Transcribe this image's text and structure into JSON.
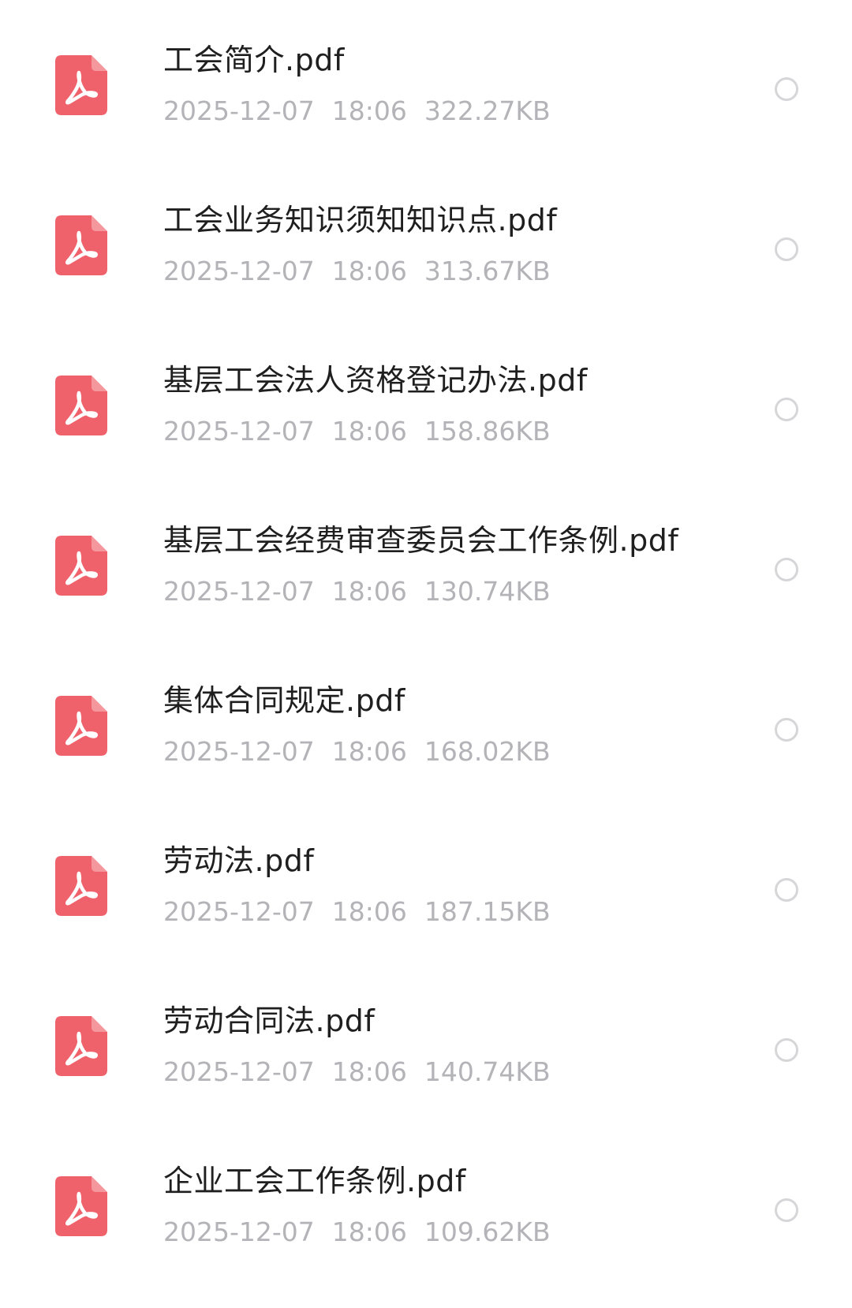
{
  "files": [
    {
      "name": "工会简介.pdf",
      "date": "2025-12-07",
      "time": "18:06",
      "size": "322.27KB"
    },
    {
      "name": "工会业务知识须知知识点.pdf",
      "date": "2025-12-07",
      "time": "18:06",
      "size": "313.67KB"
    },
    {
      "name": "基层工会法人资格登记办法.pdf",
      "date": "2025-12-07",
      "time": "18:06",
      "size": "158.86KB"
    },
    {
      "name": "基层工会经费审查委员会工作条例.pdf",
      "date": "2025-12-07",
      "time": "18:06",
      "size": "130.74KB"
    },
    {
      "name": "集体合同规定.pdf",
      "date": "2025-12-07",
      "time": "18:06",
      "size": "168.02KB"
    },
    {
      "name": "劳动法.pdf",
      "date": "2025-12-07",
      "time": "18:06",
      "size": "187.15KB"
    },
    {
      "name": "劳动合同法.pdf",
      "date": "2025-12-07",
      "time": "18:06",
      "size": "140.74KB"
    },
    {
      "name": "企业工会工作条例.pdf",
      "date": "2025-12-07",
      "time": "18:06",
      "size": "109.62KB"
    }
  ],
  "icons": {
    "file_icon": "pdf-file-icon",
    "select_icon": "radio-unchecked-icon"
  },
  "colors": {
    "pdf_icon_bg": "#f0626b",
    "title_text": "#1f1f1f",
    "meta_text": "#b3b3b8",
    "radio_border": "#d6d6d9"
  }
}
